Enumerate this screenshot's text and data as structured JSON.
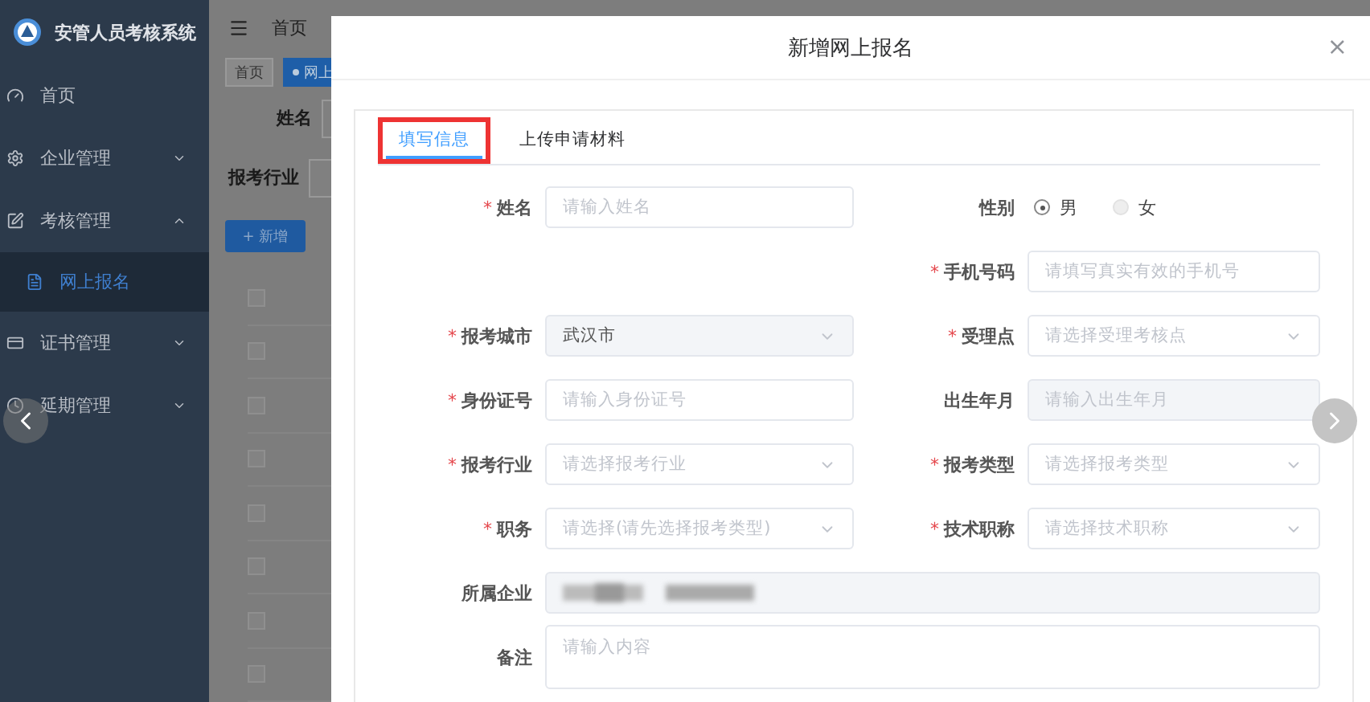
{
  "sidebar": {
    "title": "安管人员考核系统",
    "items": [
      {
        "label": "首页",
        "selected": false
      },
      {
        "label": "企业管理",
        "selected": false,
        "expanded": false
      },
      {
        "label": "考核管理",
        "selected": false,
        "expanded": true,
        "children": [
          {
            "label": "网上报名",
            "selected": true
          }
        ]
      },
      {
        "label": "证书管理",
        "selected": false,
        "expanded": false
      },
      {
        "label": "延期管理",
        "selected": false,
        "expanded": false
      }
    ]
  },
  "header": {
    "breadcrumb": "首页"
  },
  "tags": [
    {
      "label": "首页",
      "selected": false
    },
    {
      "label": "网上",
      "selected": true
    }
  ],
  "filters": [
    {
      "label": "姓名"
    },
    {
      "label": "报考行业"
    }
  ],
  "add_button": "+ 新增",
  "table": {
    "rows": [
      {
        "checked": false
      },
      {
        "checked": false
      },
      {
        "checked": false
      },
      {
        "checked": false
      },
      {
        "checked": false
      },
      {
        "checked": false
      },
      {
        "checked": false
      },
      {
        "checked": false
      }
    ]
  },
  "modal": {
    "title": "新增网上报名",
    "close": "×",
    "tabs": [
      {
        "label": "填写信息",
        "selected": true,
        "annotated": true
      },
      {
        "label": "上传申请材料",
        "selected": false,
        "annotated": false
      }
    ],
    "form": {
      "rows": [
        {
          "left": {
            "mark": "*",
            "label": "姓名",
            "kind": "input",
            "placeholder": "请输入姓名",
            "disabled": false
          },
          "right": {
            "label": "性别",
            "kind": "radio",
            "options": [
              {
                "label": "男",
                "selected": true
              },
              {
                "label": "女",
                "selected": false
              }
            ]
          }
        },
        {
          "right": {
            "mark": "*",
            "label": "手机号码",
            "kind": "input",
            "placeholder": "请填写真实有效的手机号",
            "disabled": false
          }
        },
        {
          "left": {
            "mark": "*",
            "label": "报考城市",
            "kind": "select",
            "value": "武汉市",
            "disabled": true
          },
          "right": {
            "mark": "*",
            "label": "受理点",
            "kind": "select",
            "placeholder": "请选择受理考核点",
            "disabled": false
          }
        },
        {
          "left": {
            "mark": "*",
            "label": "身份证号",
            "kind": "input",
            "placeholder": "请输入身份证号",
            "disabled": false
          },
          "right": {
            "label": "出生年月",
            "kind": "input",
            "placeholder": "请输入出生年月",
            "disabled": true
          }
        },
        {
          "left": {
            "mark": "*",
            "label": "报考行业",
            "kind": "select",
            "placeholder": "请选择报考行业",
            "disabled": false
          },
          "right": {
            "mark": "*",
            "label": "报考类型",
            "kind": "select",
            "placeholder": "请选择报考类型",
            "disabled": false
          }
        },
        {
          "left": {
            "mark": "*",
            "label": "职务",
            "kind": "select",
            "placeholder": "请选择(请先选择报考类型)",
            "disabled": false
          },
          "right": {
            "mark": "*",
            "label": "技术职称",
            "kind": "select",
            "placeholder": "请选择技术职称",
            "disabled": false
          }
        },
        {
          "full": {
            "label": "所属企业",
            "kind": "redacted",
            "disabled": true
          }
        },
        {
          "full": {
            "label": "备注",
            "kind": "textarea",
            "placeholder": "请输入内容",
            "disabled": false
          }
        }
      ]
    }
  }
}
